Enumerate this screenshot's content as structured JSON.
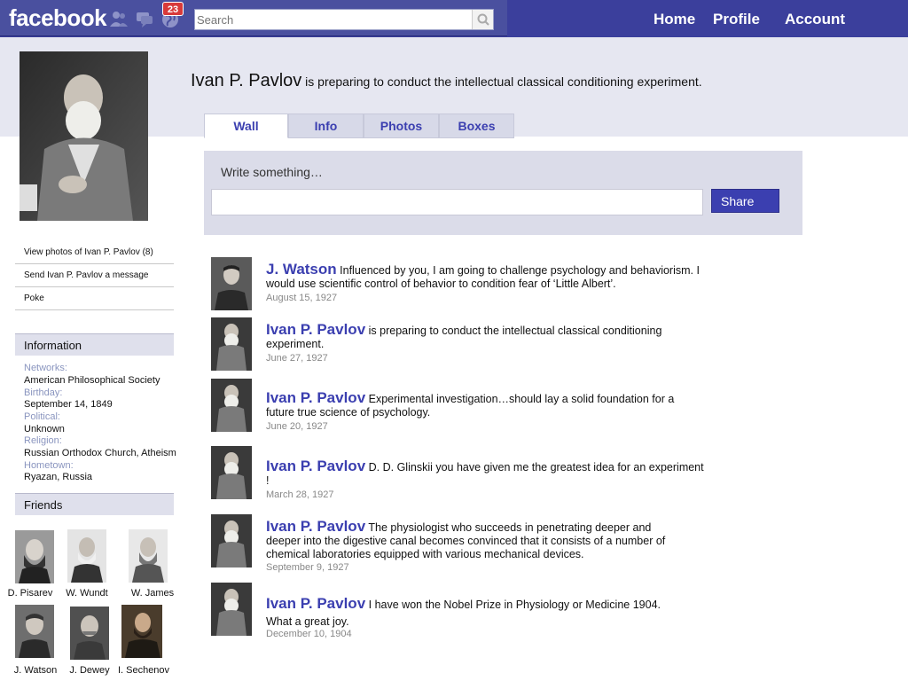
{
  "topbar": {
    "logo": "facebook",
    "notification_count": "23",
    "search_placeholder": "Search",
    "nav": [
      "Home",
      "Profile",
      "Account"
    ]
  },
  "profile": {
    "name": "Ivan P. Pavlov",
    "status": "is preparing to conduct the intellectual classical conditioning experiment."
  },
  "tabs": [
    "Wall",
    "Info",
    "Photos",
    "Boxes"
  ],
  "composer": {
    "label": "Write something…",
    "share_label": "Share"
  },
  "sidebar": {
    "links": [
      "View photos of Ivan P. Pavlov (8)",
      "Send Ivan P. Pavlov a message",
      "Poke"
    ],
    "info_heading": "Information",
    "info": [
      {
        "label": "Networks:",
        "value": "American Philosophical Society"
      },
      {
        "label": "Birthday:",
        "value": "September 14, 1849"
      },
      {
        "label": "Political:",
        "value": "Unknown"
      },
      {
        "label": "Religion:",
        "value": "Russian Orthodox Church, Atheism"
      },
      {
        "label": "Hometown:",
        "value": "Ryazan, Russia"
      }
    ],
    "friends_heading": "Friends",
    "friends": [
      "D. Pisarev",
      "W. Wundt",
      "W. James",
      "J. Watson",
      "J. Dewey",
      "I. Sechenov"
    ]
  },
  "posts": [
    {
      "name": "J. Watson",
      "text": "Influenced by you, I am going to challenge psychology and behaviorism. I would use scientific control of behavior to condition fear of ‘Little Albert’.",
      "date": "August 15, 1927"
    },
    {
      "name": "Ivan P. Pavlov",
      "text": "is preparing to conduct the intellectual classical conditioning experiment.",
      "date": "June 27, 1927"
    },
    {
      "name": "Ivan P. Pavlov",
      "text": "Experimental investigation…should lay a solid foundation for a future true science of psychology.",
      "date": "June 20, 1927"
    },
    {
      "name": "Ivan P. Pavlov",
      "text": "D. D. Glinskii you have given me the greatest idea for an experiment !",
      "date": "March 28, 1927"
    },
    {
      "name": "Ivan P. Pavlov",
      "text": "The physiologist who succeeds in penetrating deeper and deeper into the digestive canal becomes convinced that it consists of a number of chemical laboratories equipped with various mechanical devices.",
      "date": "September 9, 1927"
    },
    {
      "name": "Ivan P. Pavlov",
      "text": "I have won the Nobel Prize in Physiology or Medicine 1904. What a great joy.",
      "date": "December 10, 1904"
    }
  ],
  "colors": {
    "topbar": "#3b3f9c",
    "band": "#e6e7f1",
    "link": "#3b3fb0",
    "badge": "#d83a3a"
  }
}
